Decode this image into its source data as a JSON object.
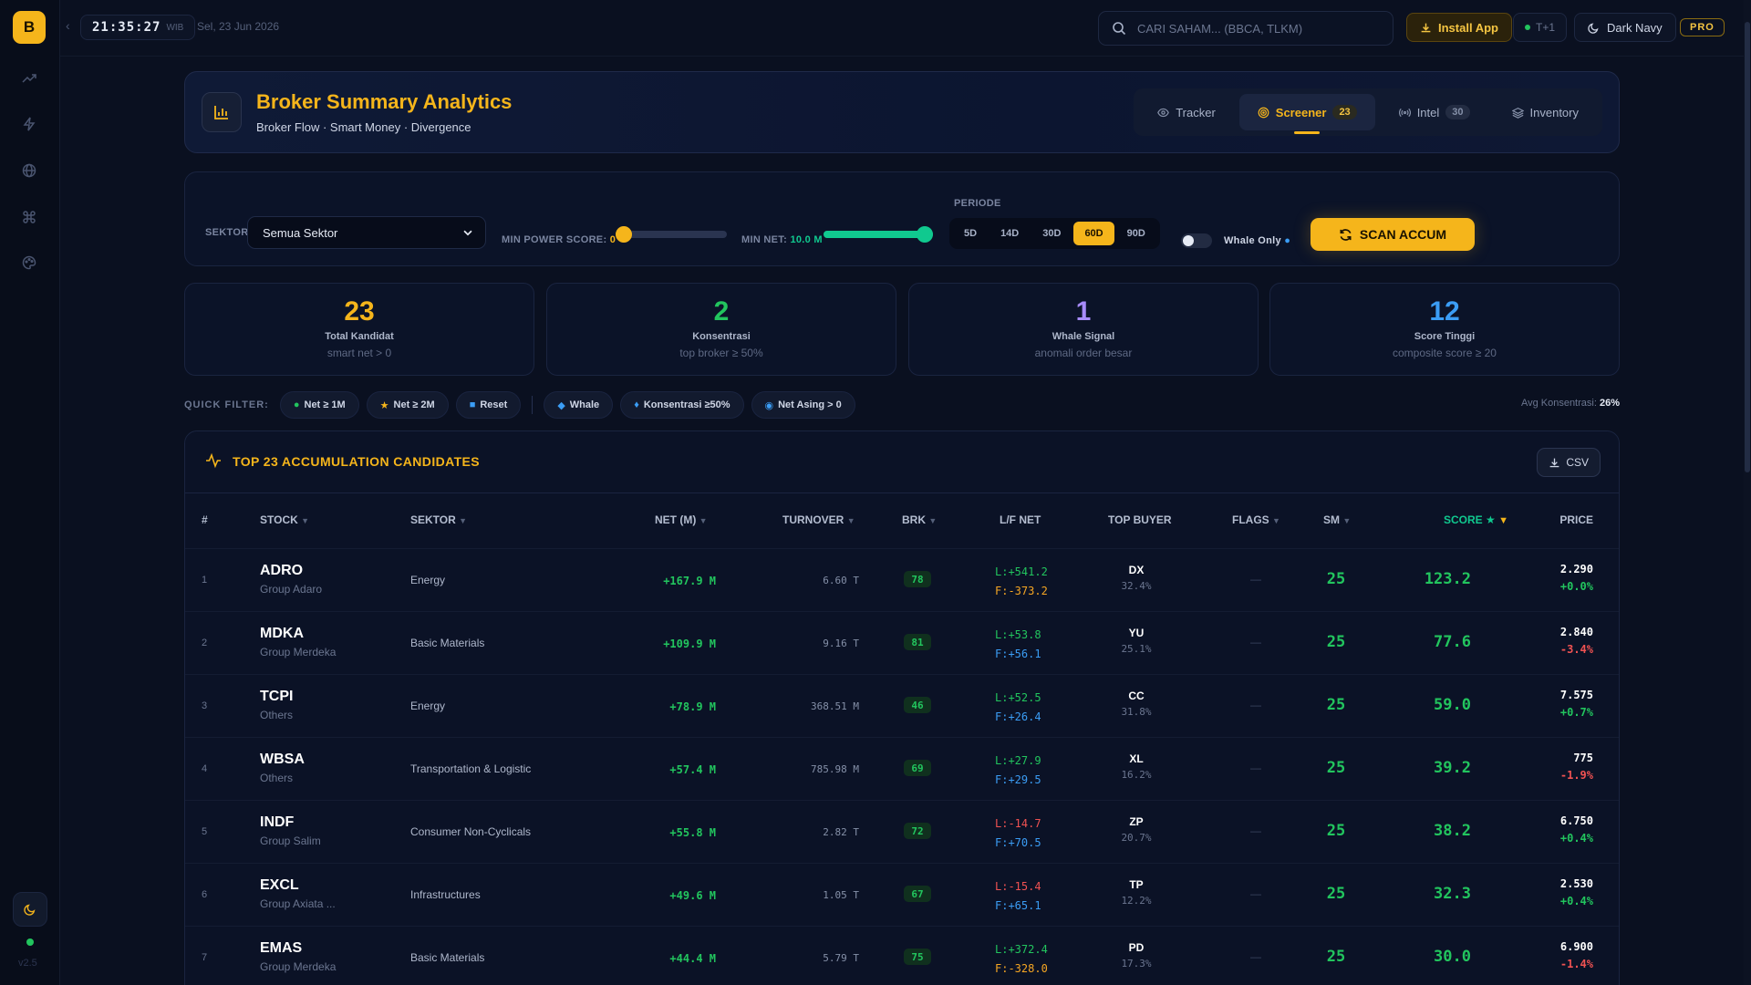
{
  "sidebar": {
    "logo": "B",
    "version": "v2.5"
  },
  "topbar": {
    "time": "21:35:27",
    "timezone": "WIB",
    "date": "Sel, 23 Jun 2026",
    "search_placeholder": "CARI SAHAM... (BBCA, TLKM)",
    "install_label": "Install App",
    "market_status": "T+1",
    "theme_label": "Dark Navy",
    "pro_label": "PRO"
  },
  "header": {
    "title": "Broker Summary Analytics",
    "subtitle": "Broker Flow · Smart Money · Divergence",
    "tabs": [
      {
        "label": "Tracker",
        "count": ""
      },
      {
        "label": "Screener",
        "count": "23"
      },
      {
        "label": "Intel",
        "count": "30"
      },
      {
        "label": "Inventory",
        "count": ""
      }
    ]
  },
  "filters": {
    "sector_label": "SEKTOR",
    "sector_value": "Semua Sektor",
    "power_label": "MIN POWER SCORE:",
    "power_value": "0",
    "power_fraction": 0,
    "net_label": "MIN NET:",
    "net_value": "10.0 M",
    "net_fraction": 1,
    "period_label": "PERIODE",
    "periods": [
      "5D",
      "14D",
      "30D",
      "60D",
      "90D"
    ],
    "active_period": "60D",
    "whale_label": "Whale Only",
    "scan_label": "SCAN ACCUM"
  },
  "stats": [
    {
      "value": "23",
      "title": "Total Kandidat",
      "sub": "smart net > 0",
      "color": "#f5b51b"
    },
    {
      "value": "2",
      "title": "Konsentrasi",
      "sub": "top broker ≥ 50%",
      "color": "#22c55e"
    },
    {
      "value": "1",
      "title": "Whale Signal",
      "sub": "anomali order besar",
      "color": "#a78bfa"
    },
    {
      "value": "12",
      "title": "Score Tinggi",
      "sub": "composite score ≥ 20",
      "color": "#3b9df5"
    }
  ],
  "quick_filter": {
    "label": "QUICK FILTER:",
    "chips": [
      "Net ≥ 1M",
      "Net ≥ 2M",
      "Reset",
      "Whale",
      "Konsentrasi ≥50%",
      "Net Asing > 0"
    ],
    "avg_label": "Avg Konsentrasi:",
    "avg_value": "26%"
  },
  "table": {
    "title": "TOP 23 ACCUMULATION CANDIDATES",
    "csv_label": "CSV",
    "headers": [
      "#",
      "STOCK",
      "SEKTOR",
      "NET (M)",
      "TURNOVER",
      "BRK",
      "L/F NET",
      "TOP BUYER",
      "FLAGS",
      "SM",
      "SCORE ★",
      "PRICE"
    ],
    "rows": [
      {
        "n": "1",
        "code": "ADRO",
        "group": "Group Adaro",
        "sector": "Energy",
        "net": "+167.9 M",
        "turnover": "6.60 T",
        "brk": "78",
        "l": "L:+541.2",
        "f": "F:-373.2",
        "buyer": "DX",
        "buyer_pct": "32.4%",
        "flags": "—",
        "sm": "25",
        "score": "123.2",
        "price": "2.290",
        "chg": "+0.0%"
      },
      {
        "n": "2",
        "code": "MDKA",
        "group": "Group Merdeka",
        "sector": "Basic Materials",
        "net": "+109.9 M",
        "turnover": "9.16 T",
        "brk": "81",
        "l": "L:+53.8",
        "f": "F:+56.1",
        "buyer": "YU",
        "buyer_pct": "25.1%",
        "flags": "—",
        "sm": "25",
        "score": "77.6",
        "price": "2.840",
        "chg": "-3.4%"
      },
      {
        "n": "3",
        "code": "TCPI",
        "group": "Others",
        "sector": "Energy",
        "net": "+78.9 M",
        "turnover": "368.51 M",
        "brk": "46",
        "l": "L:+52.5",
        "f": "F:+26.4",
        "buyer": "CC",
        "buyer_pct": "31.8%",
        "flags": "—",
        "sm": "25",
        "score": "59.0",
        "price": "7.575",
        "chg": "+0.7%"
      },
      {
        "n": "4",
        "code": "WBSA",
        "group": "Others",
        "sector": "Transportation & Logistic",
        "net": "+57.4 M",
        "turnover": "785.98 M",
        "brk": "69",
        "l": "L:+27.9",
        "f": "F:+29.5",
        "buyer": "XL",
        "buyer_pct": "16.2%",
        "flags": "—",
        "sm": "25",
        "score": "39.2",
        "price": "775",
        "chg": "-1.9%"
      },
      {
        "n": "5",
        "code": "INDF",
        "group": "Group Salim",
        "sector": "Consumer Non-Cyclicals",
        "net": "+55.8 M",
        "turnover": "2.82 T",
        "brk": "72",
        "l": "L:-14.7",
        "f": "F:+70.5",
        "buyer": "ZP",
        "buyer_pct": "20.7%",
        "flags": "—",
        "sm": "25",
        "score": "38.2",
        "price": "6.750",
        "chg": "+0.4%"
      },
      {
        "n": "6",
        "code": "EXCL",
        "group": "Group Axiata ...",
        "sector": "Infrastructures",
        "net": "+49.6 M",
        "turnover": "1.05 T",
        "brk": "67",
        "l": "L:-15.4",
        "f": "F:+65.1",
        "buyer": "TP",
        "buyer_pct": "12.2%",
        "flags": "—",
        "sm": "25",
        "score": "32.3",
        "price": "2.530",
        "chg": "+0.4%"
      },
      {
        "n": "7",
        "code": "EMAS",
        "group": "Group Merdeka",
        "sector": "Basic Materials",
        "net": "+44.4 M",
        "turnover": "5.79 T",
        "brk": "75",
        "l": "L:+372.4",
        "f": "F:-328.0",
        "buyer": "PD",
        "buyer_pct": "17.3%",
        "flags": "—",
        "sm": "25",
        "score": "30.0",
        "price": "6.900",
        "chg": "-1.4%"
      }
    ]
  }
}
